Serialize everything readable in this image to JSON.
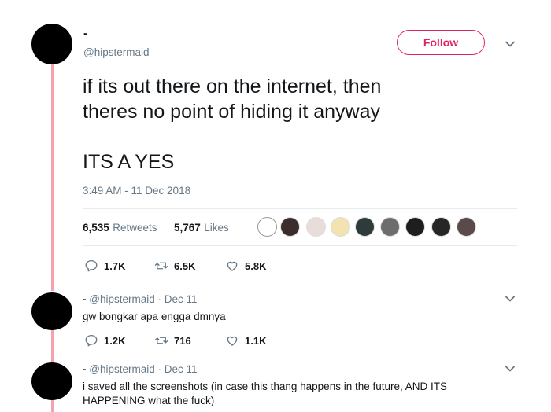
{
  "tweet": {
    "author_name": "-",
    "author_handle": "@hipstermaid",
    "follow_label": "Follow",
    "text_line1": "if its out there on the internet, then",
    "text_line2": "theres no point of hiding it anyway",
    "text_line3": "ITS A YES",
    "timestamp": "3:49 AM - 11 Dec 2018",
    "retweets_count": "6,535",
    "retweets_label": "Retweets",
    "likes_count": "5,767",
    "likes_label": "Likes",
    "actions": {
      "replies": "1.7K",
      "retweets": "6.5K",
      "likes": "5.8K"
    }
  },
  "replies": [
    {
      "name": "-",
      "handle": "@hipstermaid",
      "dot": "·",
      "date": "Dec 11",
      "text": "gw bongkar apa engga dmnya",
      "actions": {
        "replies": "1.2K",
        "retweets": "716",
        "likes": "1.1K"
      }
    },
    {
      "name": "-",
      "handle": "@hipstermaid",
      "dot": "·",
      "date": "Dec 11",
      "text_line1": "i saved all the screenshots (in case this thang happens in the future, AND ITS",
      "text_line2": "HAPPENING what the fuck)"
    }
  ],
  "colors": {
    "accent": "#e0245e",
    "thread_line": "#f4a3ad",
    "muted": "#657786",
    "text": "#14171a"
  },
  "icons": [
    "reply-icon",
    "retweet-icon",
    "like-icon",
    "chevron-down-icon"
  ]
}
